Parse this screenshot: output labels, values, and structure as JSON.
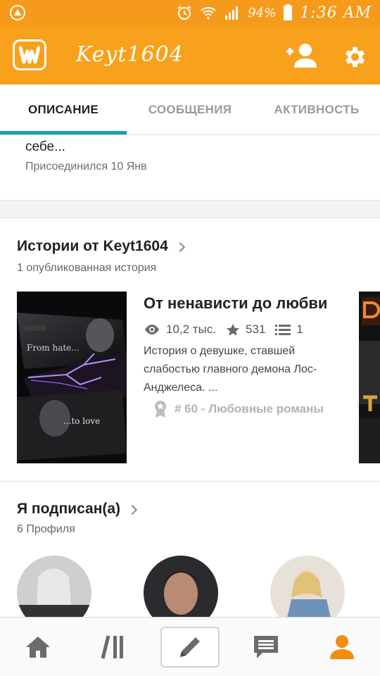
{
  "status_bar": {
    "battery_percent": "94%",
    "time": "1:36 AM",
    "icons": [
      "alarm-icon",
      "wifi-icon",
      "signal-icon",
      "battery-icon"
    ]
  },
  "app_bar": {
    "title": "Keyt1604",
    "logo_icon": "wattpad-logo-icon",
    "actions": [
      "add-user-icon",
      "gear-icon"
    ],
    "color": "#f7a11c"
  },
  "tabs": [
    {
      "label": "ОПИСАНИЕ",
      "active": true
    },
    {
      "label": "СООБЩЕНИЯ",
      "active": false
    },
    {
      "label": "АКТИВНОСТЬ",
      "active": false
    }
  ],
  "about": {
    "text_tail": "себе...",
    "joined": "Присоединился 10 Янв"
  },
  "stories": {
    "title": "Истории от Keyt1604",
    "subtitle": "1 опубликованная история",
    "items": [
      {
        "title": "От ненависти до любви",
        "reads": "10,2 тыс.",
        "votes": "531",
        "parts": "1",
        "description": "История о девушке, ставшей слабостью главного демона Лос-Анджелеса. ...",
        "rank": "# 60 - Любовные романы",
        "cover_text_top": "From hate...",
        "cover_text_bottom": "...to love"
      }
    ]
  },
  "following": {
    "title": "Я подписан(а)",
    "subtitle": "6 Профиля"
  },
  "bottom_nav": {
    "items": [
      "home-icon",
      "library-icon",
      "write-icon",
      "messages-icon",
      "profile-icon"
    ],
    "active_color": "#f28c13",
    "inactive_color": "#6b6b6b"
  }
}
